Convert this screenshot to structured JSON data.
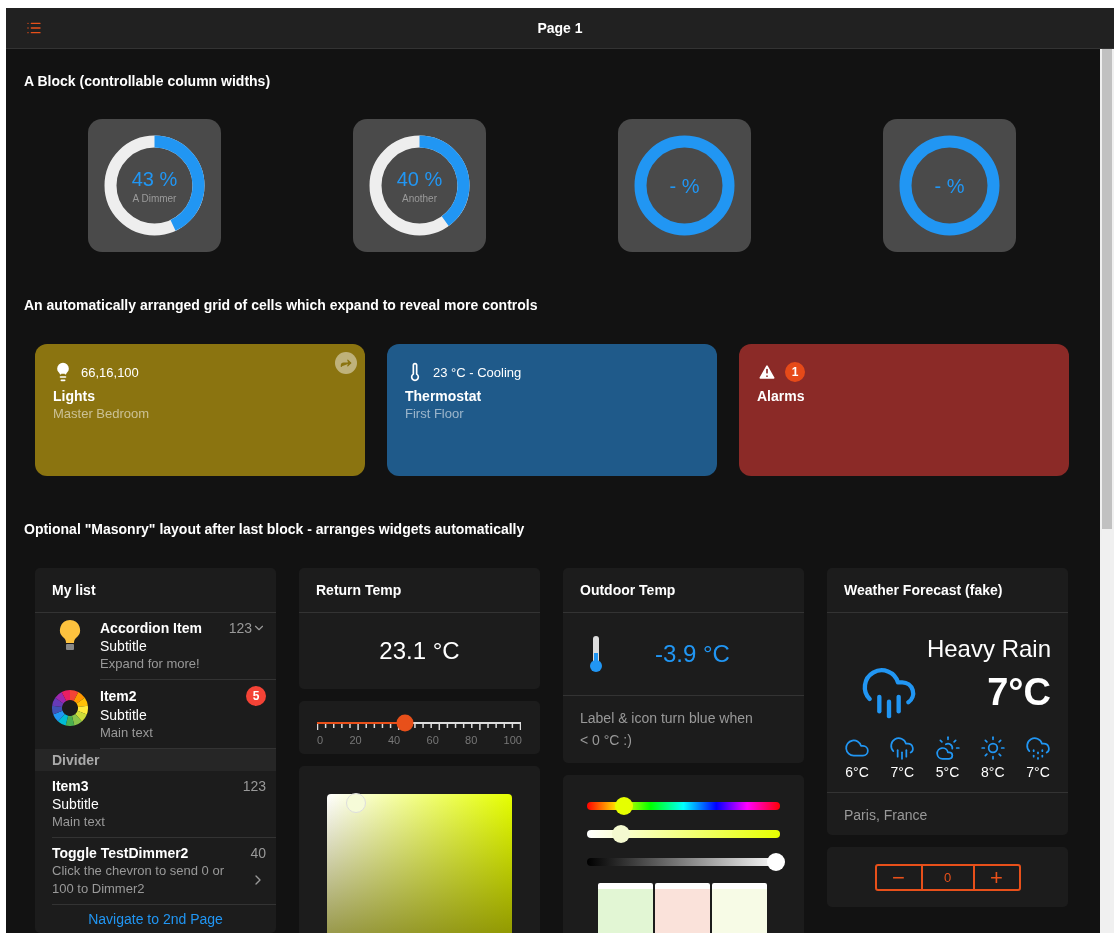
{
  "header": {
    "title": "Page 1"
  },
  "block": {
    "title": "A Block (controllable column widths)",
    "gauges": [
      {
        "value": "43 %",
        "label": "A Dimmer",
        "level": 0.43
      },
      {
        "value": "40 %",
        "label": "Another",
        "level": 0.4
      },
      {
        "value": "- %"
      },
      {
        "value": "- %"
      }
    ]
  },
  "grid": {
    "title": "An automatically arranged grid of cells which expand to reveal more controls",
    "tiles": [
      {
        "kind": "lights",
        "status": "66,16,100",
        "title": "Lights",
        "subtitle": "Master Bedroom",
        "color": "#8b7410"
      },
      {
        "kind": "thermostat",
        "status": "23 °C - Cooling",
        "title": "Thermostat",
        "subtitle": "First Floor",
        "color": "#1f5a8a"
      },
      {
        "kind": "alarms",
        "badge": "1",
        "title": "Alarms",
        "color": "#8b2a27"
      }
    ]
  },
  "masonry_title": "Optional \"Masonry\" layout after last block - arranges widgets automatically",
  "masonry": [
    {
      "widgets": [
        {
          "kind": "list",
          "title": "My list",
          "items": [
            {
              "kind": "accordion",
              "title": "Accordion Item",
              "subtitle": "Subtitle",
              "text": "Expand for more!",
              "value": "123"
            },
            {
              "kind": "badge-item",
              "title": "Item2",
              "subtitle": "Subtitle",
              "text": "Main text",
              "badge": "5"
            },
            {
              "kind": "divider",
              "title": "Divider"
            },
            {
              "kind": "plain",
              "title": "Item3",
              "subtitle": "Subtitle",
              "text": "Main text",
              "value": "123"
            },
            {
              "kind": "toggle",
              "title": "Toggle TestDimmer2",
              "text": "Click the chevron to send 0 or 100 to Dimmer2",
              "value": "40"
            },
            {
              "kind": "link",
              "title": "Navigate to 2nd Page"
            }
          ]
        }
      ]
    },
    {
      "widgets": [
        {
          "kind": "value",
          "title": "Return Temp",
          "value": "23.1 °C"
        },
        {
          "kind": "slider",
          "level": 0.43,
          "ticks": [
            "0",
            "20",
            "40",
            "60",
            "80",
            "100"
          ]
        },
        {
          "kind": "color-picker"
        }
      ]
    },
    {
      "widgets": [
        {
          "kind": "thermo",
          "title": "Outdoor Temp",
          "value": "-3.9 °C",
          "cold": true,
          "note": "Label & icon turn blue when < 0 °C :)"
        },
        {
          "kind": "color-sliders",
          "sliders": [
            {
              "kind": "hue",
              "level": 0.18
            },
            {
              "kind": "saturation",
              "level": 0.16
            },
            {
              "kind": "brightness",
              "level": 1
            }
          ],
          "swatches": [
            {
              "color": "#e2f6d4"
            },
            {
              "color": "#fae2da"
            },
            {
              "color": "#f7fbe6"
            }
          ]
        }
      ]
    },
    {
      "widgets": [
        {
          "kind": "weather",
          "title": "Weather Forecast (fake)",
          "condition": "Heavy Rain",
          "temp": "7°C",
          "forecast": [
            {
              "kind": "cloud",
              "temp": "6°C"
            },
            {
              "kind": "rain",
              "temp": "7°C"
            },
            {
              "kind": "partly-sunny",
              "temp": "5°C"
            },
            {
              "kind": "sun",
              "temp": "8°C"
            },
            {
              "kind": "heavy-rain",
              "temp": "7°C"
            }
          ],
          "location": "Paris, France"
        },
        {
          "kind": "stepper",
          "minus": "−",
          "value": "0",
          "plus": "+"
        }
      ]
    }
  ]
}
